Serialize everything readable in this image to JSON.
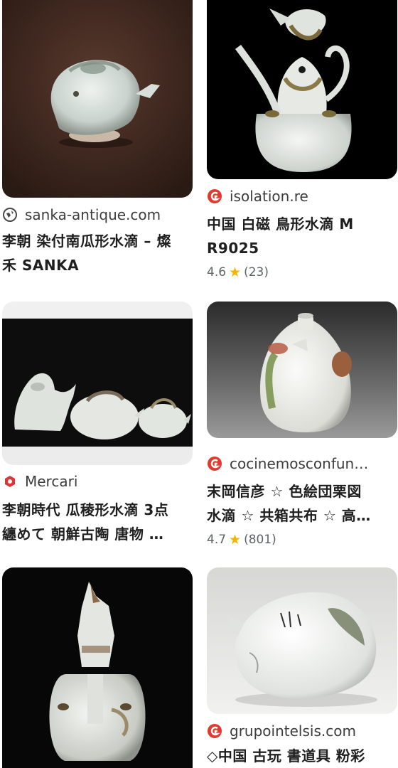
{
  "results": {
    "left": [
      {
        "source": "sanka-antique.com",
        "source_icon": "globe-icon",
        "title_lines": [
          "李朝 染付南瓜形水滴 – 燦",
          "禾 SANKA"
        ]
      },
      {
        "source": "Mercari",
        "source_icon": "mercari-icon",
        "title_lines": [
          "李朝時代 瓜稜形水滴 3点",
          "纏めて 朝鮮古陶 唐物 …"
        ]
      },
      {
        "source": "",
        "source_icon": "",
        "title_lines": []
      }
    ],
    "right": [
      {
        "source": "isolation.re",
        "source_icon": "red-site-icon",
        "title_lines": [
          "中国 白磁 鳥形水滴 M",
          "R9025"
        ],
        "rating": "4.6",
        "reviews": "(23)"
      },
      {
        "source": "cocinemosconfun…",
        "source_icon": "red-site-icon",
        "title_lines": [
          "末岡信彦 ☆ 色絵団栗図",
          "水滴 ☆ 共箱共布 ☆ 高…"
        ],
        "rating": "4.7",
        "reviews": "(801)"
      },
      {
        "source": "grupointelsis.com",
        "source_icon": "red-site-icon",
        "title_lines": [
          "◇中国 古玩 書道具 粉彩"
        ]
      }
    ]
  },
  "colors": {
    "star": "#f4b400",
    "red_icon": "#e03a2f"
  }
}
